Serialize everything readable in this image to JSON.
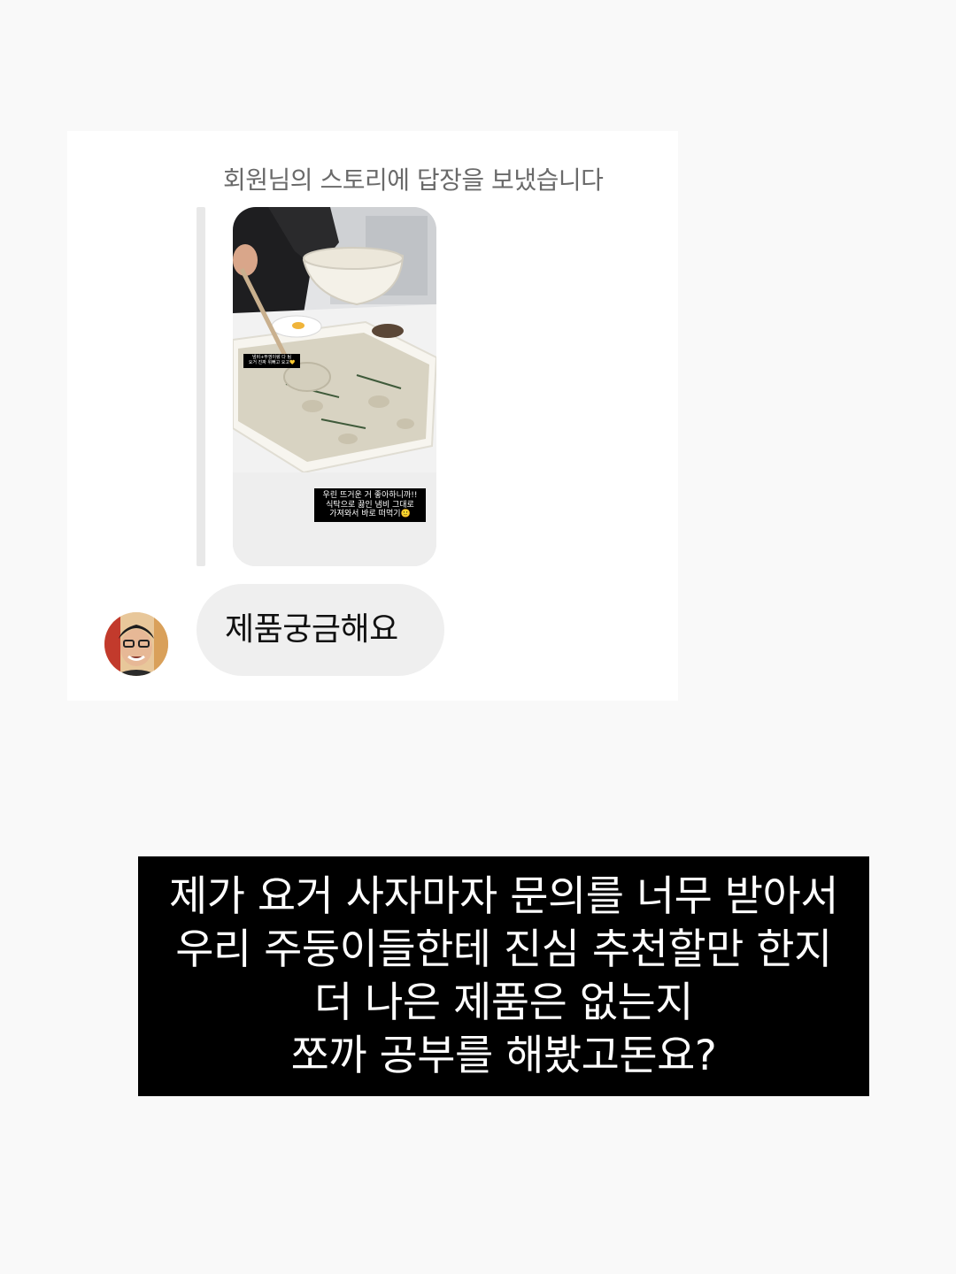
{
  "dm": {
    "reply_notice": "회원님의 스토리에 답장을 보냈습니다",
    "story_captions": {
      "small": [
        "냄비+뚜껑이랑 다 팀",
        "요거 진짜 위뻐고 요고💛"
      ],
      "main": [
        "우린 뜨거운 거 좋아하니까!!",
        "식탁으로 끓인 냄비 그대로",
        "가져와서 바로 떠먹기🙂"
      ]
    },
    "message": "제품궁금해요"
  },
  "overlay": {
    "lines": [
      "제가 요거 사자마자 문의를 너무 받아서",
      "우리 주둥이들한테 진심 추천할만 한지",
      "더 나은 제품은 없는지",
      "쪼까 공부를 해봤고돈요?"
    ]
  },
  "colors": {
    "page_background": "#f9f9f9",
    "card_background": "#ffffff",
    "bubble_background": "#efefef",
    "caption_background": "#000000",
    "caption_text": "#ffffff"
  },
  "icons": {
    "avatar": "user-avatar"
  }
}
